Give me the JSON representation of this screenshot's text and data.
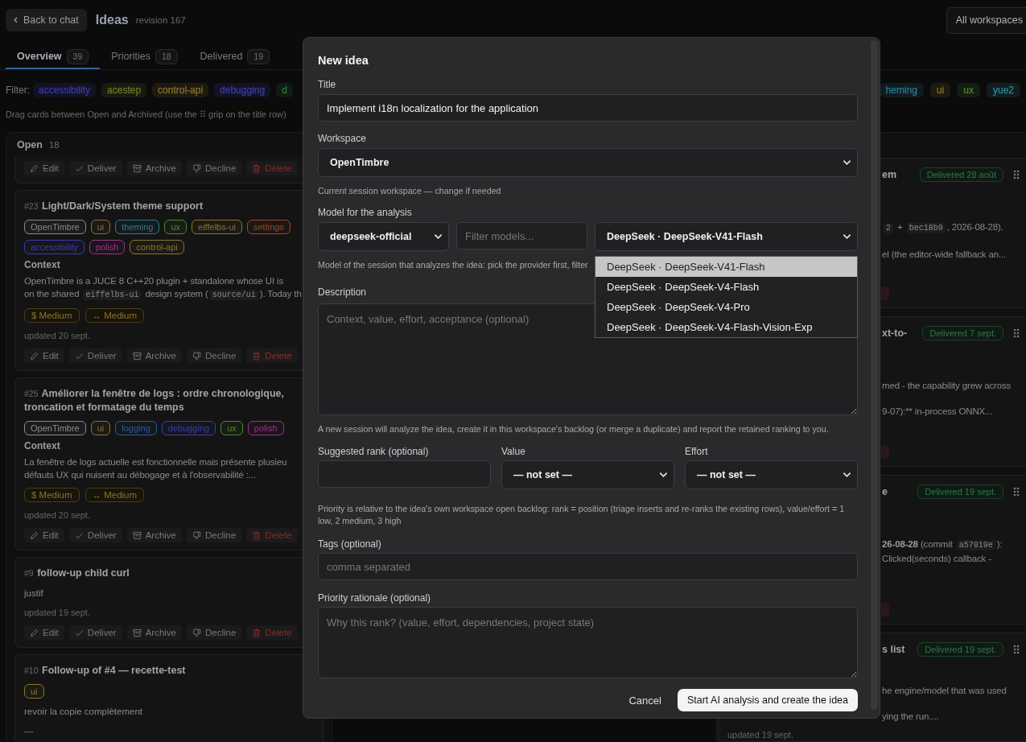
{
  "header": {
    "back_label": "Back to chat",
    "title": "Ideas",
    "revision": "revision 167",
    "workspace_button": "All workspaces"
  },
  "tabs": [
    {
      "label": "Overview",
      "count": "39",
      "selected": true
    },
    {
      "label": "Priorities",
      "count": "18",
      "selected": false
    },
    {
      "label": "Delivered",
      "count": "19",
      "selected": false
    }
  ],
  "filter": {
    "label": "Filter:",
    "tags": [
      {
        "label": "accessibility",
        "color": "#3b3bab"
      },
      {
        "label": "acestep",
        "color": "#6b7c2c"
      },
      {
        "label": "control-api",
        "color": "#8a7431"
      },
      {
        "label": "debugging",
        "color": "#3d3dae"
      },
      {
        "label": "d",
        "color": "#2f7a36"
      }
    ],
    "tags_end": [
      {
        "label": "heming",
        "color": "#2b7a94"
      },
      {
        "label": "ui",
        "color": "#8a7431"
      },
      {
        "label": "ux",
        "color": "#4b8a2e"
      },
      {
        "label": "yue2",
        "color": "#2f8a94"
      }
    ]
  },
  "hint": "Drag cards between Open and Archived (use the ⠿ grip on the title row)",
  "open_column": {
    "title": "Open",
    "count": "18",
    "cards": [
      {
        "actions": [
          {
            "kind": "edit",
            "label": "Edit"
          },
          {
            "kind": "deliver",
            "label": "Deliver"
          },
          {
            "kind": "archive",
            "label": "Archive"
          },
          {
            "kind": "decline",
            "label": "Decline"
          },
          {
            "kind": "delete",
            "label": "Delete"
          }
        ]
      },
      {
        "number": "#23",
        "title": "Light/Dark/System theme support",
        "tags": [
          {
            "label": "OpenTimbre",
            "color": "#8a8a8a"
          },
          {
            "label": "ui",
            "color": "#8a7431"
          },
          {
            "label": "theming",
            "color": "#2b7a94"
          },
          {
            "label": "ux",
            "color": "#4b8a2e"
          },
          {
            "label": "eiffelbs-ui",
            "color": "#8a7431"
          },
          {
            "label": "settings",
            "color": "#9a4a22"
          },
          {
            "label": "accessibility",
            "color": "#3b3bab"
          },
          {
            "label": "polish",
            "color": "#a1308c"
          },
          {
            "label": "control-api",
            "color": "#8a7431"
          }
        ],
        "context_label": "Context",
        "context": [
          [
            {
              "kind": "text",
              "text": "OpenTimbre is a JUCE 8 C++20 plugin + standalone whose UI is"
            }
          ],
          [
            {
              "kind": "text",
              "text": "on the shared "
            },
            {
              "kind": "code",
              "text": "eiffelbs-ui"
            },
            {
              "kind": "text",
              "text": " design system ("
            },
            {
              "kind": "code",
              "text": "source/ui"
            },
            {
              "kind": "text",
              "text": "). Today th"
            }
          ]
        ],
        "badges": [
          "$ Medium",
          "↔ Medium"
        ],
        "updated": "updated 20 sept.",
        "actions": [
          {
            "kind": "edit",
            "label": "Edit"
          },
          {
            "kind": "deliver",
            "label": "Deliver"
          },
          {
            "kind": "archive",
            "label": "Archive"
          },
          {
            "kind": "decline",
            "label": "Decline"
          },
          {
            "kind": "delete",
            "label": "Delete"
          }
        ]
      },
      {
        "number": "#25",
        "title": "Améliorer la fenêtre de logs : ordre chronologique, troncation et formatage du temps",
        "tags": [
          {
            "label": "OpenTimbre",
            "color": "#8a8a8a"
          },
          {
            "label": "ui",
            "color": "#8a7431"
          },
          {
            "label": "logging",
            "color": "#2b5c9e"
          },
          {
            "label": "debugging",
            "color": "#3d3dae"
          },
          {
            "label": "ux",
            "color": "#4b8a2e"
          },
          {
            "label": "polish",
            "color": "#a1308c"
          }
        ],
        "context_label": "Context",
        "context": [
          [
            {
              "kind": "text",
              "text": "La fenêtre de logs actuelle est fonctionnelle mais présente plusieu"
            }
          ],
          [
            {
              "kind": "text",
              "text": "défauts UX qui nuisent au débogage et à l'observabilité :..."
            }
          ]
        ],
        "badges": [
          "$ Medium",
          "↔ Medium"
        ],
        "updated": "updated 20 sept.",
        "actions": [
          {
            "kind": "edit",
            "label": "Edit"
          },
          {
            "kind": "deliver",
            "label": "Deliver"
          },
          {
            "kind": "archive",
            "label": "Archive"
          },
          {
            "kind": "decline",
            "label": "Decline"
          },
          {
            "kind": "delete",
            "label": "Delete"
          }
        ]
      },
      {
        "number": "#9",
        "title": "follow-up child curl",
        "notes": [
          "justif"
        ],
        "updated": "updated 19 sept.",
        "actions": [
          {
            "kind": "edit",
            "label": "Edit"
          },
          {
            "kind": "deliver",
            "label": "Deliver"
          },
          {
            "kind": "archive",
            "label": "Archive"
          },
          {
            "kind": "decline",
            "label": "Decline"
          },
          {
            "kind": "delete",
            "label": "Delete"
          }
        ]
      },
      {
        "number": "#10",
        "title": "Follow-up of #4 — recette-test",
        "tags": [
          {
            "label": "ui",
            "color": "#8a7431"
          }
        ],
        "notes": [
          "revoir la copie complètement",
          "---"
        ]
      }
    ]
  },
  "delivered_column": {
    "cards": [
      {
        "title": "em",
        "badge": "Delivered 28 août",
        "paragraphs": [
          [
            [
              {
                "kind": "code",
                "text": "2"
              },
              {
                "kind": "text",
                "text": " + "
              },
              {
                "kind": "code",
                "text": "bec18b0"
              },
              {
                "kind": "text",
                "text": ", 2026-08-28)."
              }
            ]
          ],
          [
            [
              {
                "kind": "text",
                "text": "el (the editor-wide fallback an..."
              }
            ]
          ]
        ],
        "actions_edge": true
      },
      {
        "title": "xt-to-",
        "badge": "Delivered 7 sept.",
        "paragraphs": [
          [
            [
              {
                "kind": "text",
                "text": "med - the capability grew across"
              }
            ]
          ],
          [
            [
              {
                "kind": "text",
                "text": "9-07):** in-process ONNX..."
              }
            ]
          ]
        ],
        "actions_edge": true
      },
      {
        "title": "e",
        "badge": "Delivered 19 sept.",
        "paragraphs": [
          [
            [
              {
                "kind": "bold",
                "text": "26-08-28"
              },
              {
                "kind": "text",
                "text": " (commit "
              },
              {
                "kind": "code",
                "text": "a57919e"
              },
              {
                "kind": "text",
                "text": "):"
              }
            ],
            [
              {
                "kind": "text",
                "text": "Clicked(seconds) callback -"
              }
            ]
          ]
        ],
        "actions_edge": true
      },
      {
        "title": "s list",
        "badge": "Delivered 19 sept.",
        "paragraphs": [
          [
            [
              {
                "kind": "text",
                "text": "he engine/model that was used"
              }
            ]
          ],
          [
            [
              {
                "kind": "text",
                "text": "ying the run...."
              }
            ]
          ]
        ],
        "updated": "updated 19 sept."
      }
    ]
  },
  "modal": {
    "title": "New idea",
    "title_field": {
      "label": "Title",
      "value": "Implement i18n localization for the application"
    },
    "workspace_field": {
      "label": "Workspace",
      "value": "OpenTimbre",
      "hint": "Current session workspace — change if needed"
    },
    "model_field": {
      "label": "Model for the analysis",
      "provider": "deepseek-official",
      "filter_placeholder": "Filter models...",
      "model": "DeepSeek · DeepSeek-V41-Flash",
      "expanded": true,
      "options": [
        {
          "label": "DeepSeek · DeepSeek-V41-Flash",
          "selected": true
        },
        {
          "label": "DeepSeek · DeepSeek-V4-Flash",
          "selected": false
        },
        {
          "label": "DeepSeek · DeepSeek-V4-Pro",
          "selected": false
        },
        {
          "label": "DeepSeek · DeepSeek-V4-Flash-Vision-Exp",
          "selected": false
        }
      ],
      "hint": "Model of the session that analyzes the idea: pick the provider first, filter"
    },
    "description_field": {
      "label": "Description",
      "placeholder": "Context, value, effort, acceptance (optional)",
      "hint": "A new session will analyze the idea, create it in this workspace's backlog (or merge a duplicate) and report the retained ranking to you."
    },
    "rank_field": {
      "label": "Suggested rank (optional)"
    },
    "value_field": {
      "label": "Value",
      "value": "— not set —"
    },
    "effort_field": {
      "label": "Effort",
      "value": "— not set —"
    },
    "priority_hint": "Priority is relative to the idea's own workspace open backlog: rank = position (triage inserts and re-ranks the existing rows), value/effort = 1 low, 2 medium, 3 high",
    "tags_field": {
      "label": "Tags (optional)",
      "placeholder": "comma separated"
    },
    "rationale_field": {
      "label": "Priority rationale (optional)",
      "placeholder": "Why this rank? (value, effort, dependencies, project state)"
    },
    "cancel": "Cancel",
    "submit": "Start AI analysis and create the idea"
  }
}
